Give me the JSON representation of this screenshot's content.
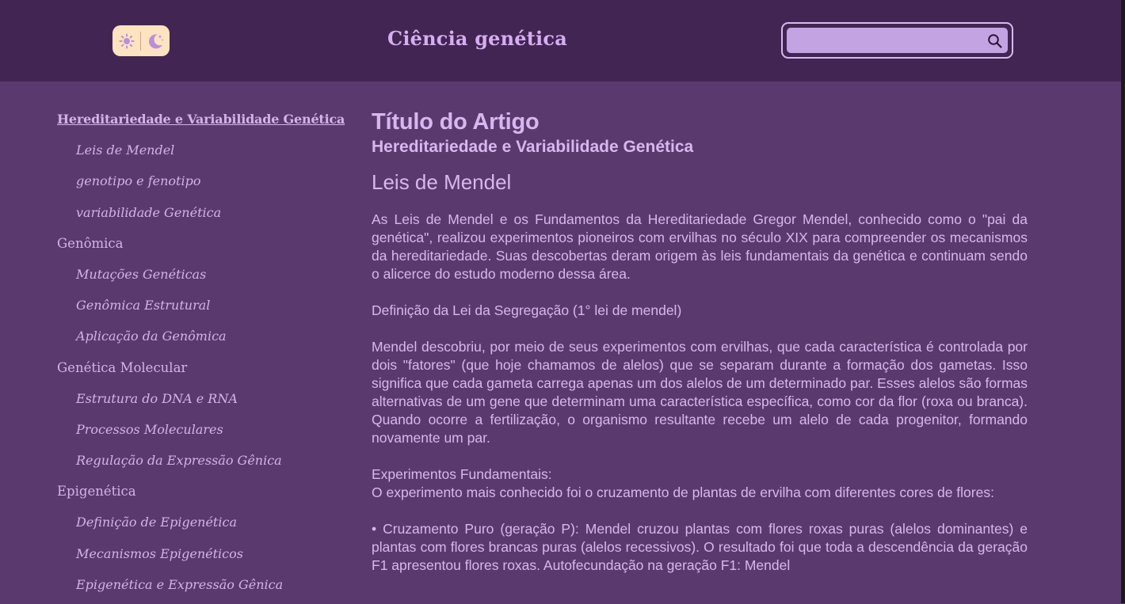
{
  "header": {
    "title": "Ciência genética",
    "search": {
      "value": "",
      "placeholder": ""
    },
    "theme_toggle": {
      "sun_icon": "sun-icon",
      "moon_icon": "moon-stars-icon"
    },
    "colors": {
      "header_bg": "#432553",
      "page_bg": "#5a3a6e",
      "text": "#d5aef0",
      "search_bg": "#c4a3e2",
      "toggle_bg": "#fde3bf"
    }
  },
  "sidebar": {
    "items": [
      {
        "label": "Hereditariedade e Variabilidade Genética",
        "level": 0,
        "active": true
      },
      {
        "label": "Leis de Mendel",
        "level": 1
      },
      {
        "label": "genotipo e fenotipo",
        "level": 1
      },
      {
        "label": "variabilidade Genética",
        "level": 1
      },
      {
        "label": "Genômica",
        "level": 0
      },
      {
        "label": "Mutações Genéticas",
        "level": 1
      },
      {
        "label": "Genômica Estrutural",
        "level": 1
      },
      {
        "label": "Aplicação da Genômica",
        "level": 1
      },
      {
        "label": "Genética Molecular",
        "level": 0
      },
      {
        "label": "Estrutura do DNA e RNA",
        "level": 1
      },
      {
        "label": "Processos Moleculares",
        "level": 1
      },
      {
        "label": "Regulação da Expressão Gênica",
        "level": 1
      },
      {
        "label": "Epigenética",
        "level": 0
      },
      {
        "label": "Definição de Epigenética",
        "level": 1
      },
      {
        "label": "Mecanismos Epigenéticos",
        "level": 1
      },
      {
        "label": "Epigenética e Expressão Gênica",
        "level": 1
      }
    ]
  },
  "article": {
    "title": "Título do Artigo",
    "subtitle": "Hereditariedade e Variabilidade Genética",
    "section_title": "Leis de Mendel",
    "paragraphs": {
      "intro": "As Leis de Mendel e os Fundamentos da Hereditariedade Gregor Mendel, conhecido como o \"pai da genética\", realizou experimentos pioneiros com ervilhas no século XIX para compreender os mecanismos da hereditariedade. Suas descobertas deram origem às leis fundamentais da genética e continuam sendo o alicerce do estudo moderno dessa área.",
      "definition_heading": "Definição da Lei da Segregação (1° lei de mendel)",
      "definition": "Mendel descobriu, por meio de seus experimentos com ervilhas, que cada característica é controlada por dois \"fatores\" (que hoje chamamos de alelos) que se separam durante a formação dos gametas. Isso significa que cada gameta carrega apenas um dos alelos de um determinado par. Esses alelos são formas alternativas de um gene que determinam uma característica específica, como cor da flor (roxa ou branca). Quando ocorre a fertilização, o organismo resultante recebe um alelo de cada progenitor, formando novamente um par.",
      "experiments_heading": "Experimentos Fundamentais:",
      "experiments_intro": "O experimento mais conhecido foi o cruzamento de plantas de ervilha com diferentes cores de flores:",
      "bullet_1": "• Cruzamento Puro (geração P): Mendel cruzou plantas com flores roxas puras (alelos dominantes) e plantas com flores brancas puras (alelos recessivos). O resultado foi que toda a descendência da geração F1 apresentou flores roxas. Autofecundação na geração F1: Mendel"
    }
  }
}
